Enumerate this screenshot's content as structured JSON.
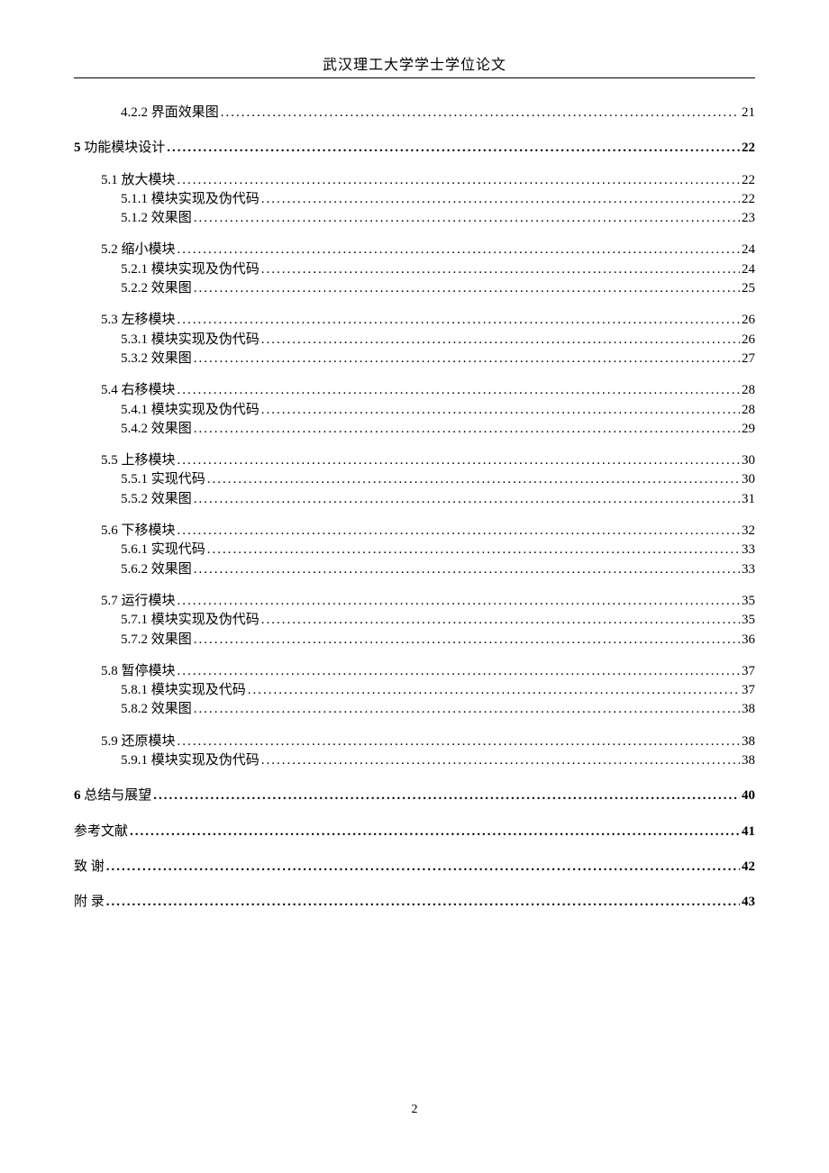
{
  "header": "武汉理工大学学士学位论文",
  "page_number": "2",
  "toc": [
    {
      "level": 2,
      "label": "4.2.2 界面效果图",
      "page": "21",
      "gap": false
    },
    {
      "level": 0,
      "label": "5 功能模块设计",
      "page": "22",
      "gap": false
    },
    {
      "level": 1,
      "label": "5.1 放大模块",
      "page": "22",
      "gap": true
    },
    {
      "level": 2,
      "label": "5.1.1 模块实现及伪代码",
      "page": "22",
      "gap": false
    },
    {
      "level": 2,
      "label": "5.1.2 效果图",
      "page": "23",
      "gap": false
    },
    {
      "level": 1,
      "label": "5.2 缩小模块",
      "page": "24",
      "gap": true
    },
    {
      "level": 2,
      "label": "5.2.1 模块实现及伪代码",
      "page": "24",
      "gap": false
    },
    {
      "level": 2,
      "label": "5.2.2 效果图",
      "page": "25",
      "gap": false
    },
    {
      "level": 1,
      "label": "5.3 左移模块",
      "page": "26",
      "gap": true
    },
    {
      "level": 2,
      "label": "5.3.1 模块实现及伪代码",
      "page": "26",
      "gap": false
    },
    {
      "level": 2,
      "label": "5.3.2 效果图",
      "page": "27",
      "gap": false
    },
    {
      "level": 1,
      "label": "5.4 右移模块",
      "page": "28",
      "gap": true
    },
    {
      "level": 2,
      "label": "5.4.1 模块实现及伪代码",
      "page": "28",
      "gap": false
    },
    {
      "level": 2,
      "label": "5.4.2 效果图",
      "page": "29",
      "gap": false
    },
    {
      "level": 1,
      "label": "5.5 上移模块",
      "page": "30",
      "gap": true
    },
    {
      "level": 2,
      "label": "5.5.1 实现代码",
      "page": "30",
      "gap": false
    },
    {
      "level": 2,
      "label": "5.5.2 效果图",
      "page": "31",
      "gap": false
    },
    {
      "level": 1,
      "label": "5.6 下移模块",
      "page": "32",
      "gap": true
    },
    {
      "level": 2,
      "label": "5.6.1 实现代码",
      "page": "33",
      "gap": false
    },
    {
      "level": 2,
      "label": "5.6.2 效果图",
      "page": "33",
      "gap": false
    },
    {
      "level": 1,
      "label": "5.7 运行模块",
      "page": "35",
      "gap": true
    },
    {
      "level": 2,
      "label": "5.7.1 模块实现及伪代码",
      "page": "35",
      "gap": false
    },
    {
      "level": 2,
      "label": "5.7.2 效果图",
      "page": "36",
      "gap": false
    },
    {
      "level": 1,
      "label": "5.8 暂停模块",
      "page": "37",
      "gap": true
    },
    {
      "level": 2,
      "label": "5.8.1 模块实现及代码",
      "page": "37",
      "gap": false
    },
    {
      "level": 2,
      "label": "5.8.2 效果图",
      "page": "38",
      "gap": false
    },
    {
      "level": 1,
      "label": "5.9 还原模块",
      "page": "38",
      "gap": true
    },
    {
      "level": 2,
      "label": "5.9.1 模块实现及伪代码",
      "page": "38",
      "gap": false
    },
    {
      "level": 0,
      "label": "6 总结与展望",
      "page": "40",
      "gap": false
    },
    {
      "level": 0,
      "label": "参考文献",
      "page": "41",
      "gap": false
    },
    {
      "level": 0,
      "label": "致 谢",
      "page": "42",
      "gap": false
    },
    {
      "level": 0,
      "label": "附 录",
      "page": "43",
      "gap": false
    }
  ]
}
